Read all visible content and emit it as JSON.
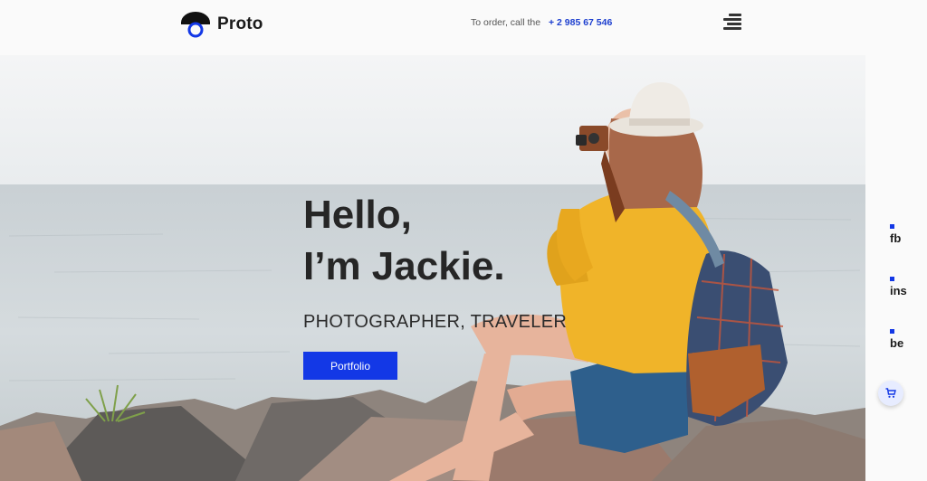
{
  "header": {
    "logo_text": "Proto",
    "order_text": "To order, call the",
    "phone": "+ 2 985 67 546"
  },
  "hero": {
    "headline_line1": "Hello,",
    "headline_line2": "I’m Jackie.",
    "subtitle": "PHOTOGRAPHER, TRAVELER",
    "button_label": "Portfolio"
  },
  "social": {
    "items": [
      {
        "label": "fb"
      },
      {
        "label": "ins"
      },
      {
        "label": "be"
      }
    ]
  },
  "icons": {
    "logo": "logo-icon",
    "menu": "hamburger-menu-icon",
    "cart": "cart-icon"
  },
  "colors": {
    "accent": "#1338e6",
    "phone": "#1d3fcf",
    "text_dark": "#262626"
  }
}
